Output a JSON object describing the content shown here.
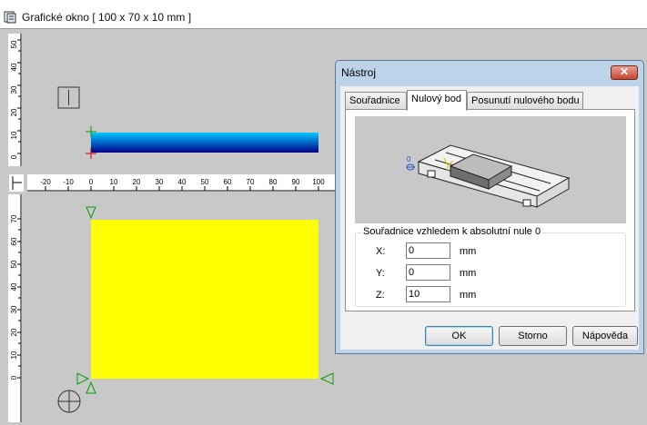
{
  "window": {
    "title": "Grafické okno [ 100 x 70 x 10 mm ]",
    "icon": "graphic-window-icon"
  },
  "ruler_top_left": {
    "ticks": [
      "50",
      "40",
      "30",
      "20",
      "10",
      "0"
    ]
  },
  "ruler_horizontal": {
    "ticks": [
      "-20",
      "-10",
      "0",
      "10",
      "20",
      "30",
      "40",
      "50",
      "60",
      "70",
      "80",
      "90",
      "100"
    ]
  },
  "ruler_bottom_left": {
    "ticks": [
      "70",
      "60",
      "50",
      "40",
      "30",
      "20",
      "10",
      "0"
    ]
  },
  "colors": {
    "yellow": "#ffff00",
    "bar_dark": "#00008a",
    "bar_light": "#00c8ff",
    "dialog_frame": "#bcd3ea"
  },
  "dialog": {
    "title": "Nástroj",
    "close_label": "✕",
    "tabs": [
      "Souřadnice",
      "Nulový bod",
      "Posunutí nulového bodu"
    ],
    "active_tab": "Nulový bod",
    "preview_zero_label": "0",
    "group_label": "Souřadnice vzhledem k absolutní nule 0",
    "rows": [
      {
        "label": "X:",
        "value": "0",
        "unit": "mm"
      },
      {
        "label": "Y:",
        "value": "0",
        "unit": "mm"
      },
      {
        "label": "Z:",
        "value": "10",
        "unit": "mm"
      }
    ],
    "buttons": {
      "ok": "OK",
      "cancel": "Storno",
      "help": "Nápověda"
    }
  }
}
